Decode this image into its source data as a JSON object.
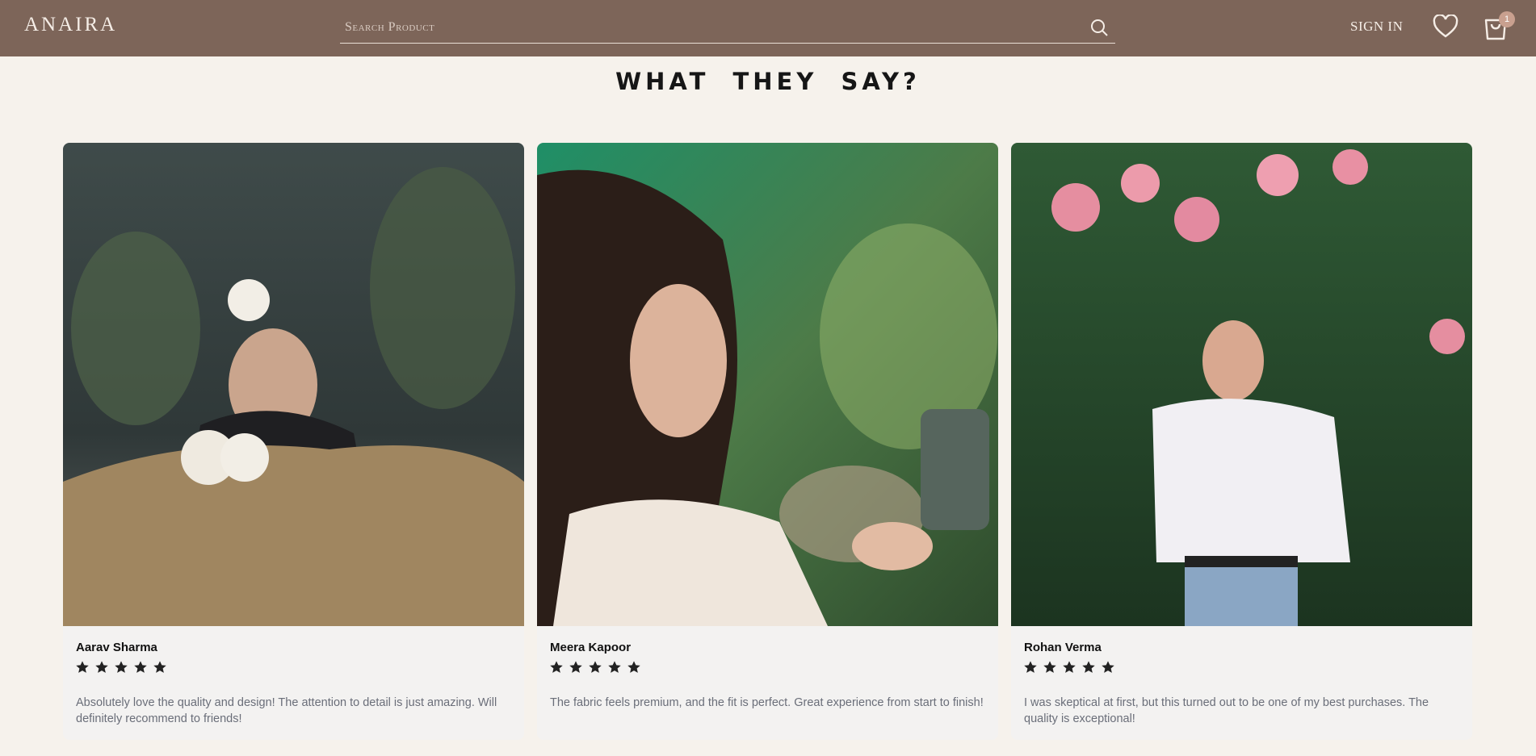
{
  "header": {
    "logo": "ANAIRA",
    "search_placeholder": "Search Product",
    "sign_in": "SIGN IN",
    "cart_count": "1"
  },
  "section": {
    "title": "WHAT  THEY SAY?"
  },
  "reviews": [
    {
      "name": "Aarav Sharma",
      "rating": 5,
      "text": "Absolutely love the quality and design! The attention to detail is just amazing. Will definitely recommend to friends!"
    },
    {
      "name": "Meera Kapoor",
      "rating": 5,
      "text": "The fabric feels premium, and the fit is perfect. Great experience from start to finish!"
    },
    {
      "name": "Rohan Verma",
      "rating": 5,
      "text": "I was skeptical at first, but this turned out to be one of my best purchases. The quality is exceptional!"
    }
  ],
  "colors": {
    "header_bg": "#7d6559",
    "page_bg": "#f6f2ec",
    "card_bg": "#f3f2f1",
    "badge": "#c9a08f"
  }
}
